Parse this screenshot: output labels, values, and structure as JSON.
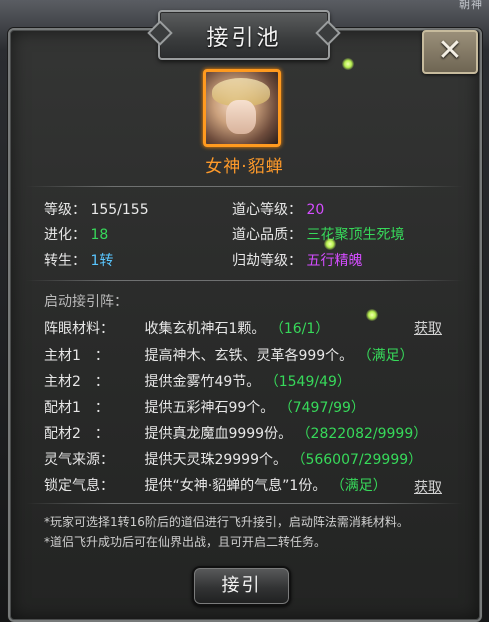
{
  "corner_text": "朝神",
  "title": "接引池",
  "character": {
    "name": "女神·貂蝉"
  },
  "stats": {
    "level_label": "等级：",
    "level_value": "155/155",
    "evolve_label": "进化：",
    "evolve_value": "18",
    "rebirth_label": "转生：",
    "rebirth_value": "1转",
    "dao_level_label": "道心等级：",
    "dao_level_value": "20",
    "dao_quality_label": "道心品质：",
    "dao_quality_value": "三花聚顶生死境",
    "guijie_label": "归劫等级：",
    "guijie_value": "五行精魄"
  },
  "section_head": "启动接引阵：",
  "requirements": [
    {
      "label": "阵眼材料：",
      "text": "收集玄机神石1颗。",
      "progress": "（16/1）",
      "link": "获取"
    },
    {
      "label": "主材1　：",
      "text": "提高神木、玄铁、灵革各999个。",
      "progress": "（满足）",
      "link": ""
    },
    {
      "label": "主材2　：",
      "text": "提供金雾竹49节。",
      "progress": "（1549/49）",
      "link": ""
    },
    {
      "label": "配材1　：",
      "text": "提供五彩神石99个。",
      "progress": "（7497/99）",
      "link": ""
    },
    {
      "label": "配材2　：",
      "text": "提供真龙魔血9999份。",
      "progress": "（2822082/9999）",
      "link": ""
    },
    {
      "label": "灵气来源：",
      "text": "提供天灵珠29999个。",
      "progress": "（566007/29999）",
      "link": ""
    },
    {
      "label": "锁定气息：",
      "text": "提供“女神·貂蝉的气息”1份。",
      "progress": "（满足）",
      "link": "获取"
    }
  ],
  "notes": [
    "*玩家可选择1转16阶后的道侣进行飞升接引，启动阵法需消耗材料。",
    "*道侣飞升成功后可在仙界出战，且可开启二转任务。"
  ],
  "action_button": "接引",
  "colors": {
    "accent_orange": "#ff9a2a",
    "green": "#37d95a",
    "cyan": "#59c6ff",
    "purple": "#d44dff"
  },
  "icons": {
    "close": "close-icon",
    "avatar": "character-portrait"
  }
}
